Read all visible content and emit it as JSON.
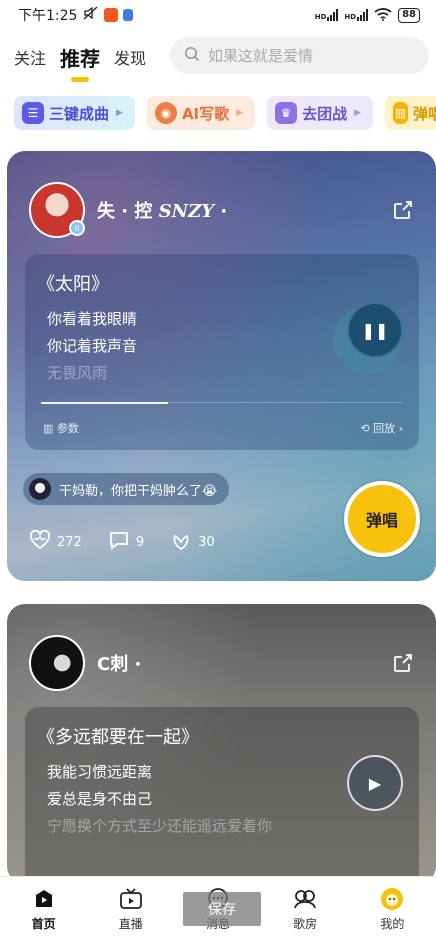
{
  "status_bar": {
    "time": "下午1:25",
    "signal_1": "HD",
    "signal_2": "HD",
    "battery": "88"
  },
  "header": {
    "tabs": [
      {
        "label": "关注",
        "active": false
      },
      {
        "label": "推荐",
        "active": true
      },
      {
        "label": "发现",
        "active": false
      }
    ],
    "search_placeholder": "如果这就是爱情",
    "accent_color": "#f7c300"
  },
  "chips": [
    {
      "label": "三键成曲",
      "icon": "music-bars-icon"
    },
    {
      "label": "AI写歌",
      "icon": "ai-icon"
    },
    {
      "label": "去团战",
      "icon": "trophy-icon"
    },
    {
      "label": "弹唱",
      "icon": "guitar-icon"
    }
  ],
  "feed": [
    {
      "username": "失 · 控",
      "username_italic": "SNZY",
      "username_suffix": "·",
      "song_title": "《太阳》",
      "lyrics": [
        "你看着我眼睛",
        "你记着我声音",
        "无畏风雨"
      ],
      "play_state": "playing",
      "progress": 0.35,
      "params_label": "参数",
      "replay_label": "回放",
      "comment_text": "干妈勒，你把干妈肿么了😭",
      "stats": {
        "likes": "272",
        "comments": "9",
        "gifts": "30"
      },
      "sing_label": "弹唱"
    },
    {
      "username": "C刺",
      "username_suffix": "·",
      "song_title": "《多远都要在一起》",
      "lyrics": [
        "我能习惯远距离",
        "爱总是身不由己",
        "宁愿换个方式至少还能遥远爱着你"
      ],
      "play_state": "paused"
    }
  ],
  "bottom_nav": [
    {
      "label": "首页",
      "icon": "home-play-icon",
      "active": true
    },
    {
      "label": "直播",
      "icon": "tv-icon",
      "active": false
    },
    {
      "label": "消息",
      "icon": "message-icon",
      "active": false
    },
    {
      "label": "歌房",
      "icon": "room-icon",
      "active": false
    },
    {
      "label": "我的",
      "icon": "profile-avatar-icon",
      "active": false
    }
  ],
  "overlay": {
    "save_label": "保存"
  }
}
